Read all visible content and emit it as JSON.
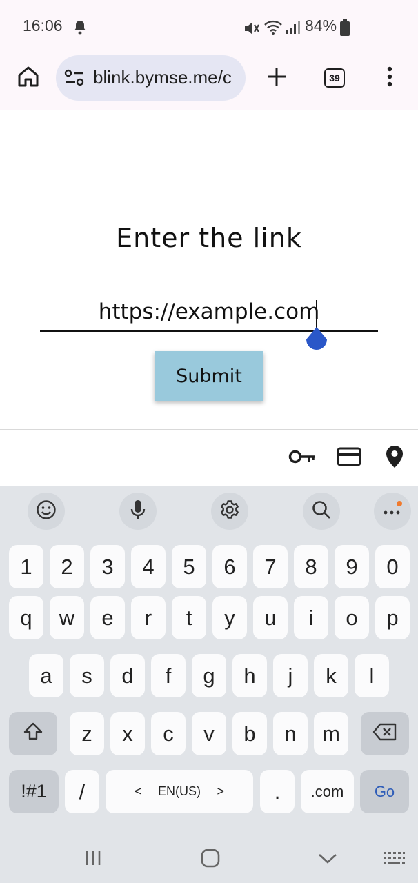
{
  "status_bar": {
    "time": "16:06",
    "battery_percent": "84%",
    "icons": [
      "notification-bell-icon",
      "mute-icon",
      "wifi-icon",
      "signal-icon",
      "battery-icon"
    ]
  },
  "browser": {
    "url": "blink.bymse.me/c",
    "tab_count": "39",
    "icons": [
      "home-icon",
      "site-settings-icon",
      "new-tab-plus-icon",
      "tab-switcher-icon",
      "more-menu-icon"
    ]
  },
  "page": {
    "heading": "Enter the link",
    "input_value": "https://example.com",
    "submit_label": "Submit"
  },
  "autofill": {
    "icons": [
      "key-icon",
      "credit-card-icon",
      "location-pin-icon"
    ]
  },
  "keyboard": {
    "toolbar_icons": [
      "emoji-icon",
      "microphone-icon",
      "settings-gear-icon",
      "search-icon",
      "more-options-icon"
    ],
    "number_row": [
      "1",
      "2",
      "3",
      "4",
      "5",
      "6",
      "7",
      "8",
      "9",
      "0"
    ],
    "row1": [
      "q",
      "w",
      "e",
      "r",
      "t",
      "y",
      "u",
      "i",
      "o",
      "p"
    ],
    "row2": [
      "a",
      "s",
      "d",
      "f",
      "g",
      "h",
      "j",
      "k",
      "l"
    ],
    "row3": [
      "z",
      "x",
      "c",
      "v",
      "b",
      "n",
      "m"
    ],
    "symbols_label": "!#1",
    "slash_label": "/",
    "space_label": "EN(US)",
    "space_left": "<",
    "space_right": ">",
    "period_label": ".",
    "dotcom_label": ".com",
    "go_label": "Go",
    "accent_color": "#2f5db8",
    "notification_dot_color": "#f07a2d"
  },
  "navigation": {
    "icons": [
      "recent-apps-icon",
      "home-button-icon",
      "hide-keyboard-icon",
      "keyboard-switch-icon"
    ]
  }
}
